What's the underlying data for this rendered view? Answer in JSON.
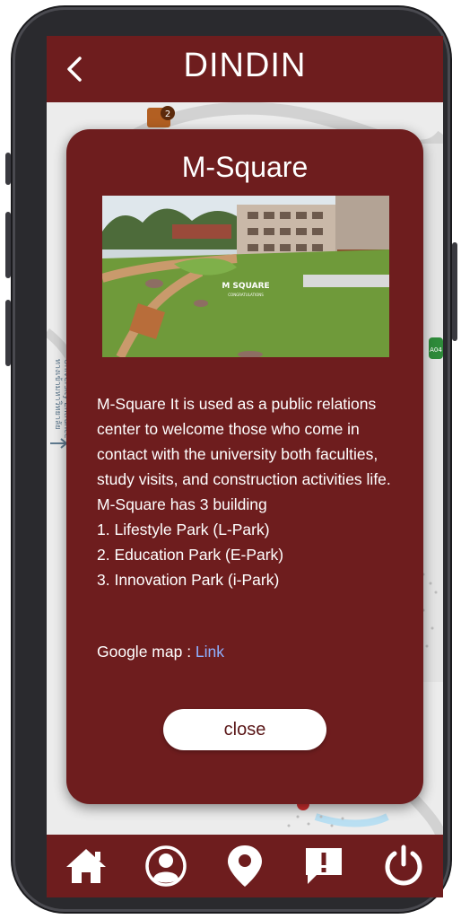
{
  "header": {
    "back_icon": "chevron-left-icon",
    "title": "DINDIN"
  },
  "modal": {
    "title": "M-Square",
    "photo_sign": "M SQUARE",
    "photo_sign_sub": "CONGRATULATIONS",
    "description": "M-Square It is used as a public relations center to welcome those who come in contact with the university both faculties, study visits, and construction activities life.\nM-Square has 3 building\n1. Lifestyle Park    (L-Park)\n2. Education Park (E-Park)\n3. Innovation Park  (i-Park)",
    "google_map_label": "Google map : ",
    "google_map_link": "Link",
    "close_label": "close"
  },
  "map": {
    "marker_number": "2",
    "side_label": "University Entrance",
    "side_label_2": "ทางเข้ามหาวิทยาลัย",
    "side_badge": "A04"
  },
  "bottom_nav": {
    "items": [
      {
        "icon": "home-icon"
      },
      {
        "icon": "profile-icon"
      },
      {
        "icon": "location-pin-icon"
      },
      {
        "icon": "report-icon"
      },
      {
        "icon": "power-icon"
      }
    ]
  },
  "colors": {
    "primary": "#6e1d1e",
    "link": "#8fb0ff",
    "button_bg": "#ffffff"
  }
}
